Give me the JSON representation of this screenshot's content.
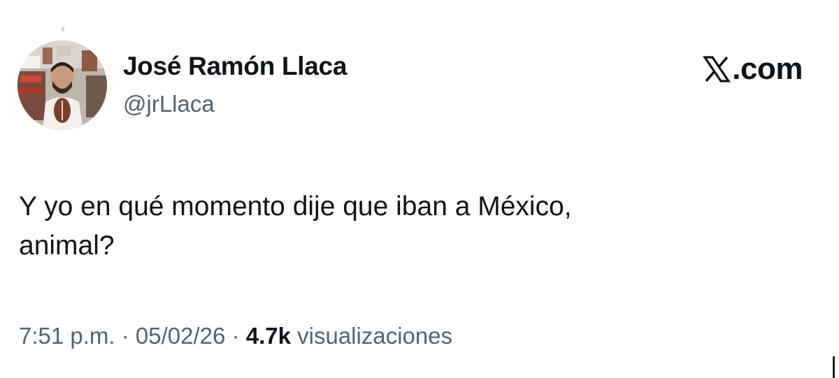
{
  "author": {
    "display_name": "José Ramón Llaca",
    "handle": "@jrLlaca"
  },
  "brand": {
    "label": ".com",
    "logo_icon": "x-logo-icon"
  },
  "tweet": {
    "text": "Y yo en qué momento dije que iban a México,\nanimal?"
  },
  "meta": {
    "time": "7:51 p.m.",
    "separator": "·",
    "date": "05/02/26",
    "views_count": "4.7k",
    "views_label": "visualizaciones"
  },
  "colors": {
    "primary_text": "#0f1419",
    "secondary_text": "#536471",
    "background": "#ffffff"
  }
}
